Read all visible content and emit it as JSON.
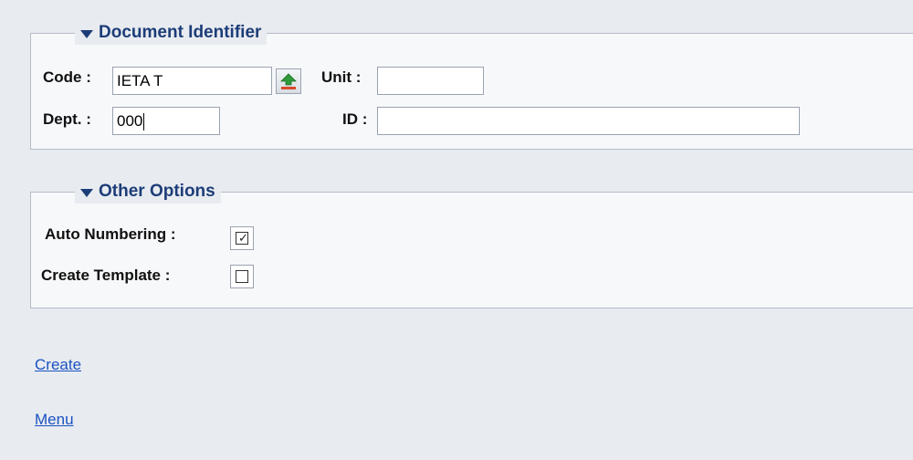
{
  "document_identifier": {
    "title": "Document Identifier",
    "code_label": "Code :",
    "code_value": "IETA T",
    "unit_label": "Unit :",
    "unit_value": "",
    "dept_label": "Dept. :",
    "dept_value": "000",
    "id_label": "ID :",
    "id_value": ""
  },
  "other_options": {
    "title": "Other Options",
    "auto_numbering_label": "Auto Numbering :",
    "auto_numbering_checked": true,
    "create_template_label": "Create Template :",
    "create_template_checked": false
  },
  "links": {
    "create": "Create",
    "menu": "Menu"
  },
  "icons": {
    "legend_toggle": "triangle-down-icon",
    "lookup": "lookup-arrow-icon",
    "check": "checkmark-icon"
  },
  "colors": {
    "legend": "#1d3d78",
    "link": "#1a52c2",
    "background": "#e8ebf0"
  }
}
